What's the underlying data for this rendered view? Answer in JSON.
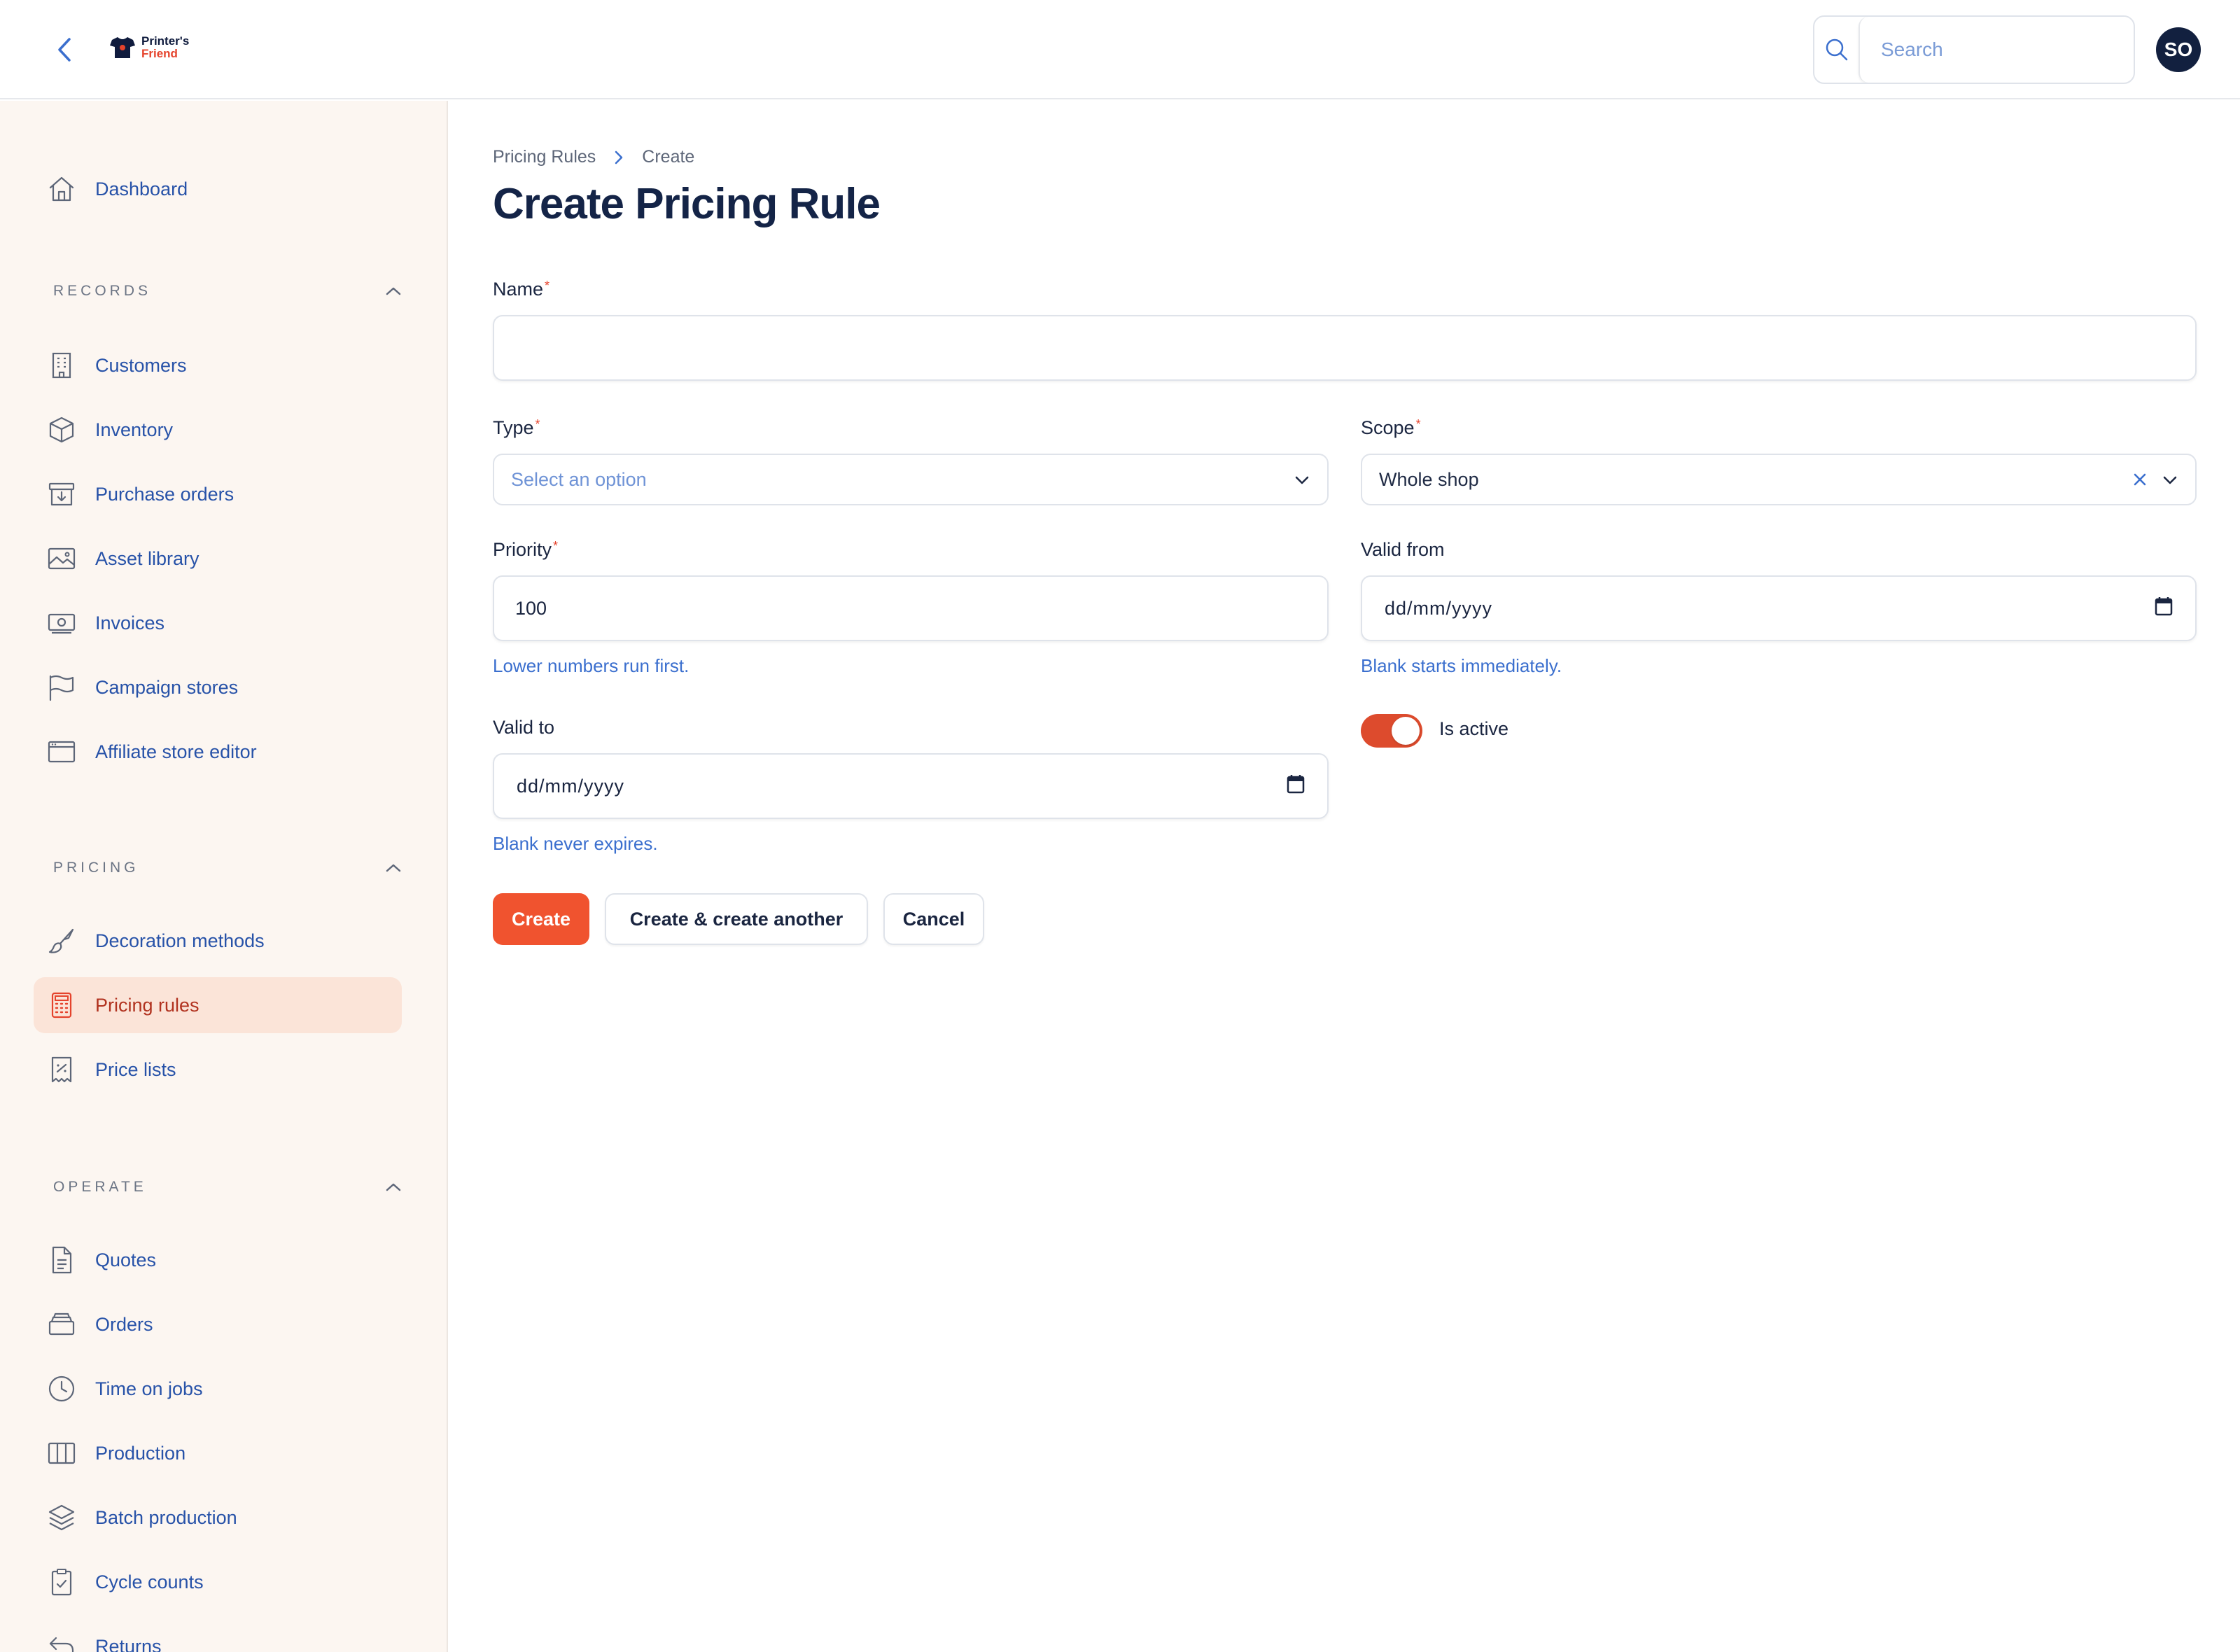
{
  "brand": {
    "line1": "Printer's",
    "line2": "Friend"
  },
  "header": {
    "search_placeholder": "Search",
    "avatar_initials": "SO"
  },
  "sidebar": {
    "dashboard": "Dashboard",
    "sections": {
      "records": "RECORDS",
      "pricing": "PRICING",
      "operate": "OPERATE"
    },
    "records_items": [
      "Customers",
      "Inventory",
      "Purchase orders",
      "Asset library",
      "Invoices",
      "Campaign stores",
      "Affiliate store editor"
    ],
    "pricing_items": [
      "Decoration methods",
      "Pricing rules",
      "Price lists"
    ],
    "operate_items": [
      "Quotes",
      "Orders",
      "Time on jobs",
      "Production",
      "Batch production",
      "Cycle counts",
      "Returns"
    ]
  },
  "breadcrumb": {
    "parent": "Pricing Rules",
    "current": "Create"
  },
  "page_title": "Create Pricing Rule",
  "form": {
    "name": {
      "label": "Name",
      "required_mark": "*",
      "value": ""
    },
    "type": {
      "label": "Type",
      "required_mark": "*",
      "placeholder": "Select an option"
    },
    "scope": {
      "label": "Scope",
      "required_mark": "*",
      "value": "Whole shop"
    },
    "priority": {
      "label": "Priority",
      "required_mark": "*",
      "value": "100",
      "hint": "Lower numbers run first."
    },
    "valid_from": {
      "label": "Valid from",
      "value": "dd/mm/yyyy",
      "hint": "Blank starts immediately."
    },
    "valid_to": {
      "label": "Valid to",
      "value": "dd/mm/yyyy",
      "hint": "Blank never expires."
    },
    "is_active": {
      "label": "Is active",
      "on": true
    }
  },
  "actions": {
    "create": "Create",
    "create_another": "Create & create another",
    "cancel": "Cancel"
  },
  "colors": {
    "accent": "#f0532f",
    "nav_text": "#2752a8",
    "active_bg": "#fbe4d8",
    "sidebar_bg": "#fcf6f1",
    "title": "#142447"
  }
}
